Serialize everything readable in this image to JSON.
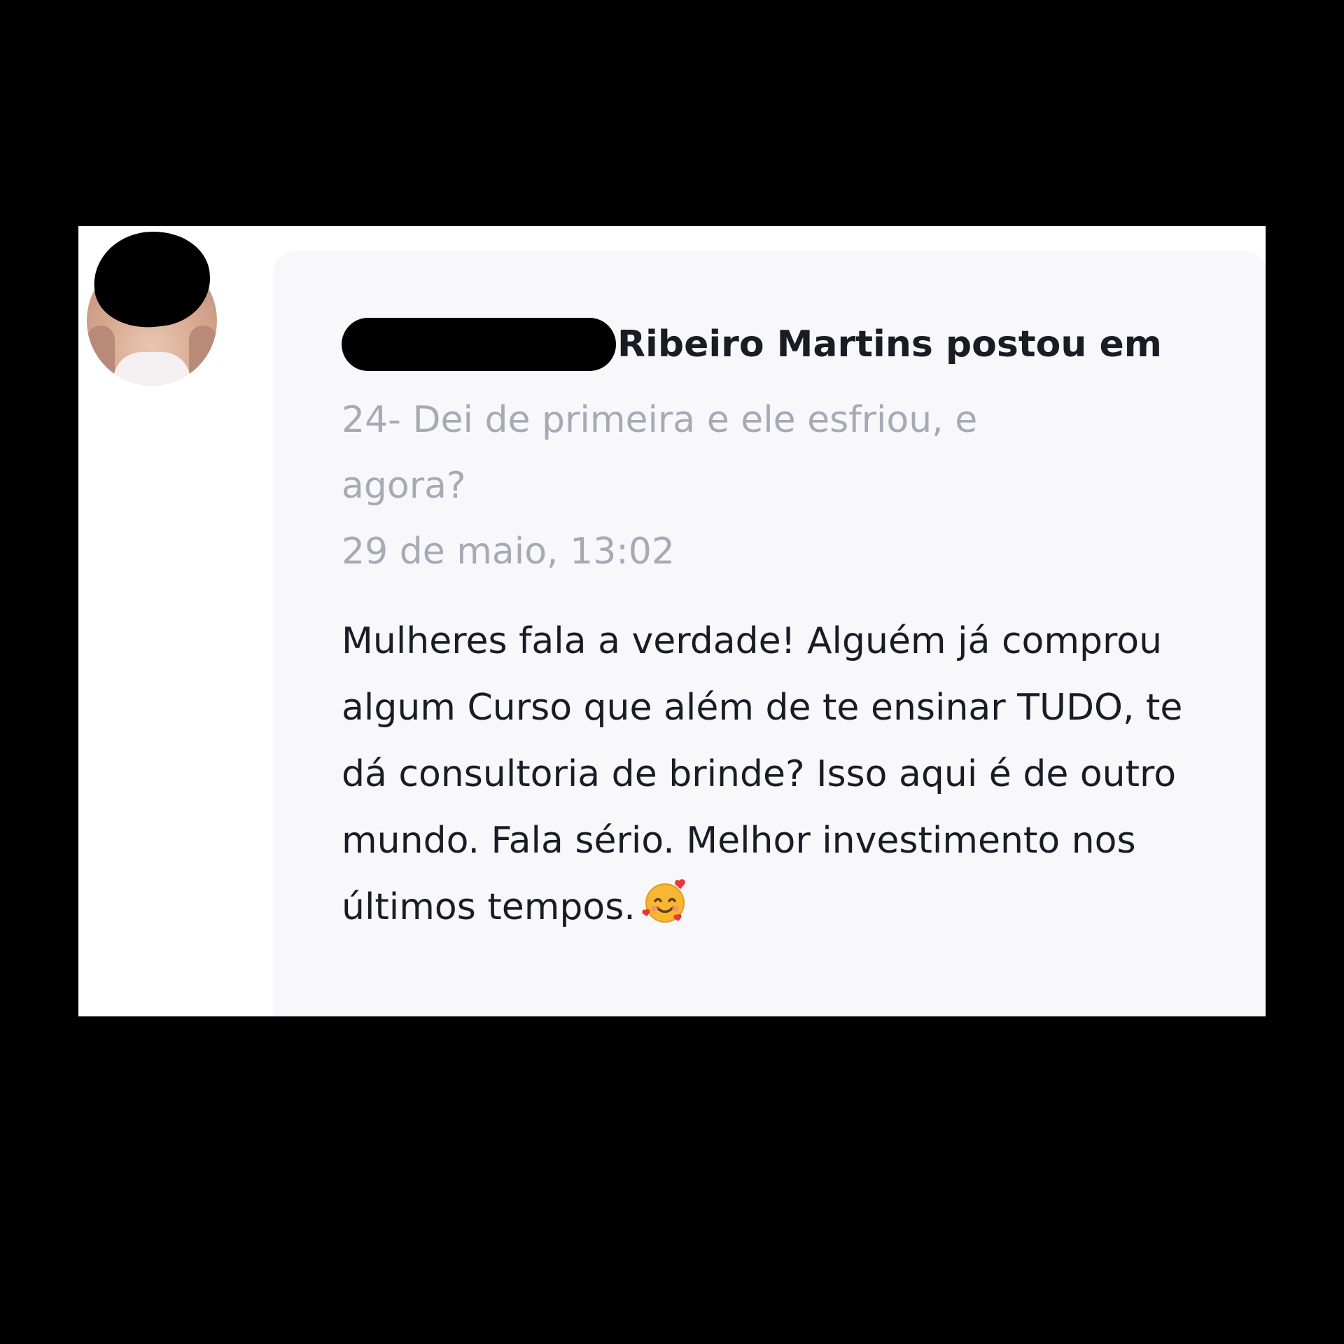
{
  "post": {
    "author_visible": "Ribeiro Martins",
    "action": "postou em",
    "topic": "24- Dei de primeira e ele esfriou, e agora?",
    "timestamp": "29 de maio, 13:02",
    "body": "Mulheres fala a verdade! Alguém já comprou algum Curso que além de te ensinar TUDO, te dá consultoria de brinde? Isso aqui é de outro mundo. Fala sério. Melhor investimento nos últimos tempos.",
    "emoji": "smiling-face-with-hearts-icon"
  },
  "colors": {
    "background": "#000000",
    "card": "#f8f8fb",
    "primary_text": "#1b1b24",
    "muted_text": "#a9a9b4"
  }
}
